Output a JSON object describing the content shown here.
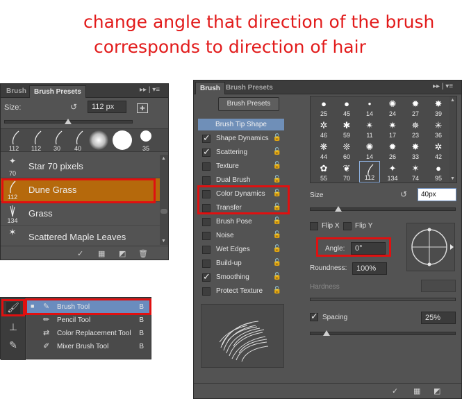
{
  "headline": {
    "line1": "change angle that direction of the brush",
    "line2": "corresponds to direction of hair"
  },
  "presets_panel": {
    "tabs": [
      "Brush",
      "Brush Presets"
    ],
    "tab_controls": "▸▸ | ▾≡",
    "size_label": "Size:",
    "size_value": "112 px",
    "thumbnails": [
      "112",
      "112",
      "30",
      "40",
      "",
      "",
      "35"
    ],
    "items": [
      {
        "num": "70",
        "name": "Star 70 pixels"
      },
      {
        "num": "112",
        "name": "Dune Grass"
      },
      {
        "num": "134",
        "name": "Grass"
      },
      {
        "num": "",
        "name": "Scattered Maple Leaves"
      }
    ]
  },
  "tools_panel": {
    "items": [
      {
        "name": "Brush Tool",
        "key": "B"
      },
      {
        "name": "Pencil Tool",
        "key": "B"
      },
      {
        "name": "Color Replacement Tool",
        "key": "B"
      },
      {
        "name": "Mixer Brush Tool",
        "key": "B"
      }
    ]
  },
  "brush_panel": {
    "tabs": [
      "Brush",
      "Brush Presets"
    ],
    "presets_button": "Brush Presets",
    "tip_shape_header": "Brush Tip Shape",
    "options": [
      {
        "label": "Shape Dynamics",
        "checked": true
      },
      {
        "label": "Scattering",
        "checked": true
      },
      {
        "label": "Texture",
        "checked": false
      },
      {
        "label": "Dual Brush",
        "checked": false
      },
      {
        "label": "Color Dynamics",
        "checked": false
      },
      {
        "label": "Transfer",
        "checked": false
      },
      {
        "label": "Brush Pose",
        "checked": false
      },
      {
        "label": "Noise",
        "checked": false
      },
      {
        "label": "Wet Edges",
        "checked": false
      },
      {
        "label": "Build-up",
        "checked": false
      },
      {
        "label": "Smoothing",
        "checked": true
      },
      {
        "label": "Protect Texture",
        "checked": false
      }
    ],
    "tip_grid": [
      "25",
      "45",
      "14",
      "24",
      "27",
      "39",
      "46",
      "59",
      "11",
      "17",
      "23",
      "36",
      "44",
      "60",
      "14",
      "26",
      "33",
      "42",
      "55",
      "70",
      "112",
      "134",
      "74",
      "95"
    ],
    "size_label": "Size",
    "size_value": "40px",
    "flip_x": "Flip X",
    "flip_y": "Flip Y",
    "angle_label": "Angle:",
    "angle_value": "0°",
    "roundness_label": "Roundness:",
    "roundness_value": "100%",
    "hardness_label": "Hardness",
    "spacing_label": "Spacing",
    "spacing_value": "25%",
    "spacing_checked": true
  }
}
